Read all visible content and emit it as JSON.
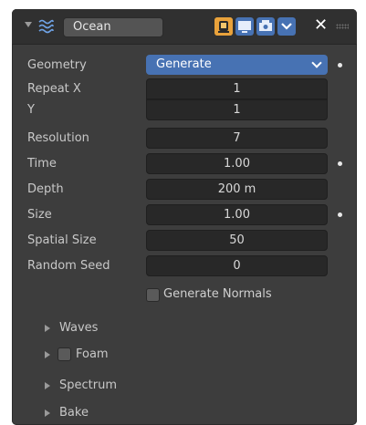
{
  "header": {
    "modifier_name": "Ocean",
    "icons": [
      "expand-arrow-icon",
      "ocean-modifier-icon",
      "edit-mode-icon",
      "viewport-display-icon",
      "render-display-icon",
      "dropdown-icon",
      "close-icon",
      "drag-handle-icon"
    ],
    "close_glyph": "✕"
  },
  "fields": {
    "geometry": {
      "label": "Geometry",
      "value": "Generate"
    },
    "repeat_x": {
      "label": "Repeat X",
      "value": "1"
    },
    "repeat_y": {
      "label": "Y",
      "value": "1"
    },
    "resolution": {
      "label": "Resolution",
      "value": "7"
    },
    "time": {
      "label": "Time",
      "value": "1.00"
    },
    "depth": {
      "label": "Depth",
      "value": "200 m"
    },
    "size": {
      "label": "Size",
      "value": "1.00"
    },
    "spatial_size": {
      "label": "Spatial Size",
      "value": "50"
    },
    "random_seed": {
      "label": "Random Seed",
      "value": "0"
    }
  },
  "generate_normals": {
    "label": "Generate Normals",
    "checked": false
  },
  "subpanels": [
    {
      "label": "Waves",
      "has_checkbox": false
    },
    {
      "label": "Foam",
      "has_checkbox": true,
      "checked": false
    },
    {
      "label": "Spectrum",
      "has_checkbox": false
    },
    {
      "label": "Bake",
      "has_checkbox": false
    }
  ],
  "colors": {
    "panel_bg": "#3d3d3d",
    "header_bg": "#303030",
    "field_bg": "#282828",
    "accent": "#4772b3"
  }
}
